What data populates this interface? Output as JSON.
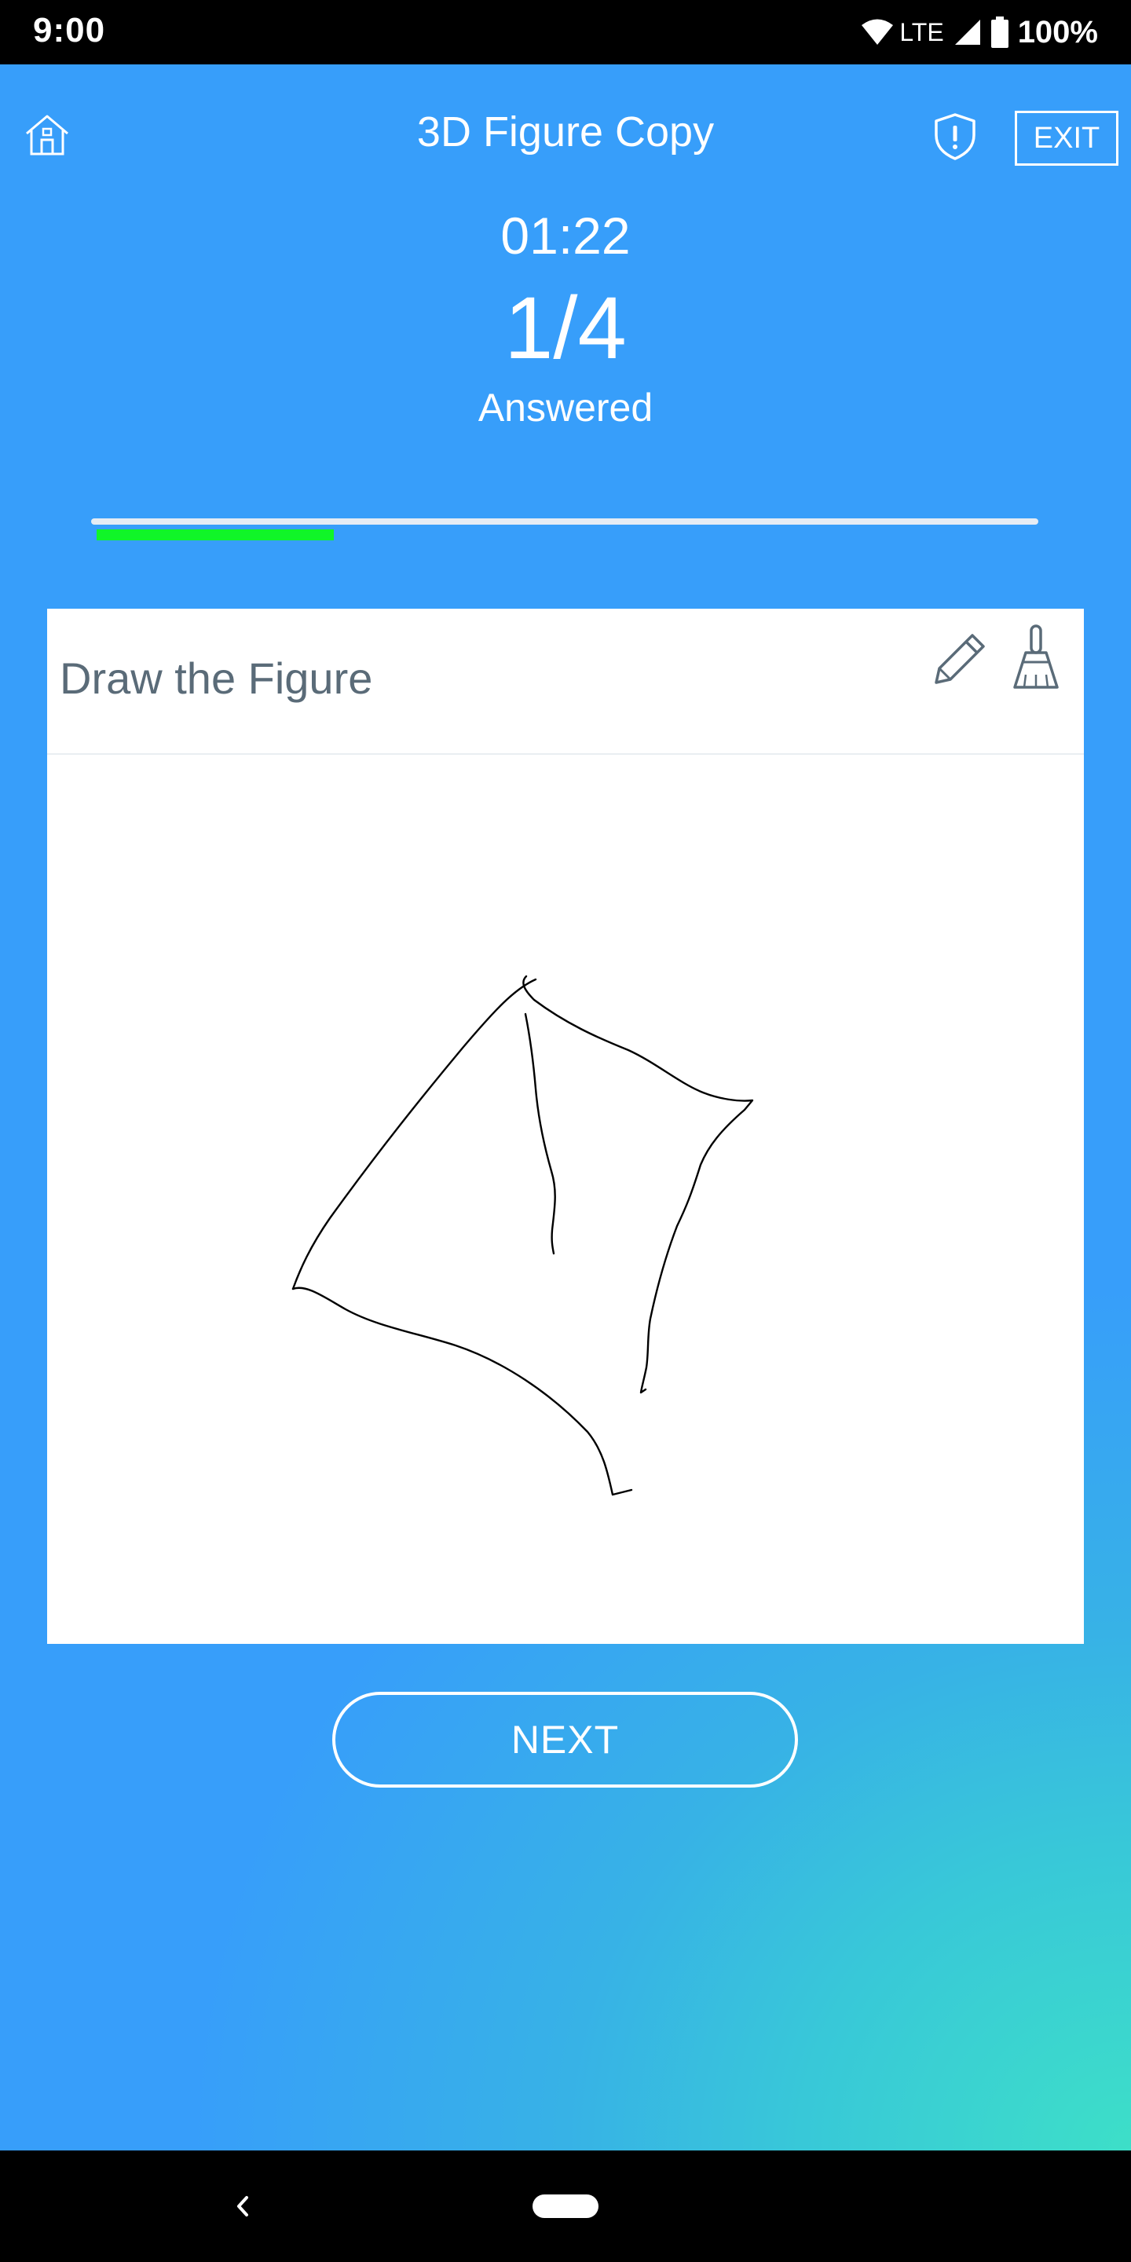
{
  "status_bar": {
    "time": "9:00",
    "network": "LTE",
    "battery": "100%"
  },
  "header": {
    "title": "3D Figure Copy",
    "exit_label": "EXIT"
  },
  "progress": {
    "timer": "01:22",
    "count": "1/4",
    "answered_label": "Answered",
    "fraction_complete": 0.25,
    "track_color": "#e5ecf4",
    "fill_color": "#10f528"
  },
  "card": {
    "title": "Draw the Figure",
    "tools": [
      "pencil-icon",
      "broom-icon"
    ]
  },
  "actions": {
    "next_label": "NEXT"
  },
  "colors": {
    "background_top": "#379efa",
    "background_bottom_right": "#3ddfc8",
    "card_title": "#5a6b78"
  }
}
